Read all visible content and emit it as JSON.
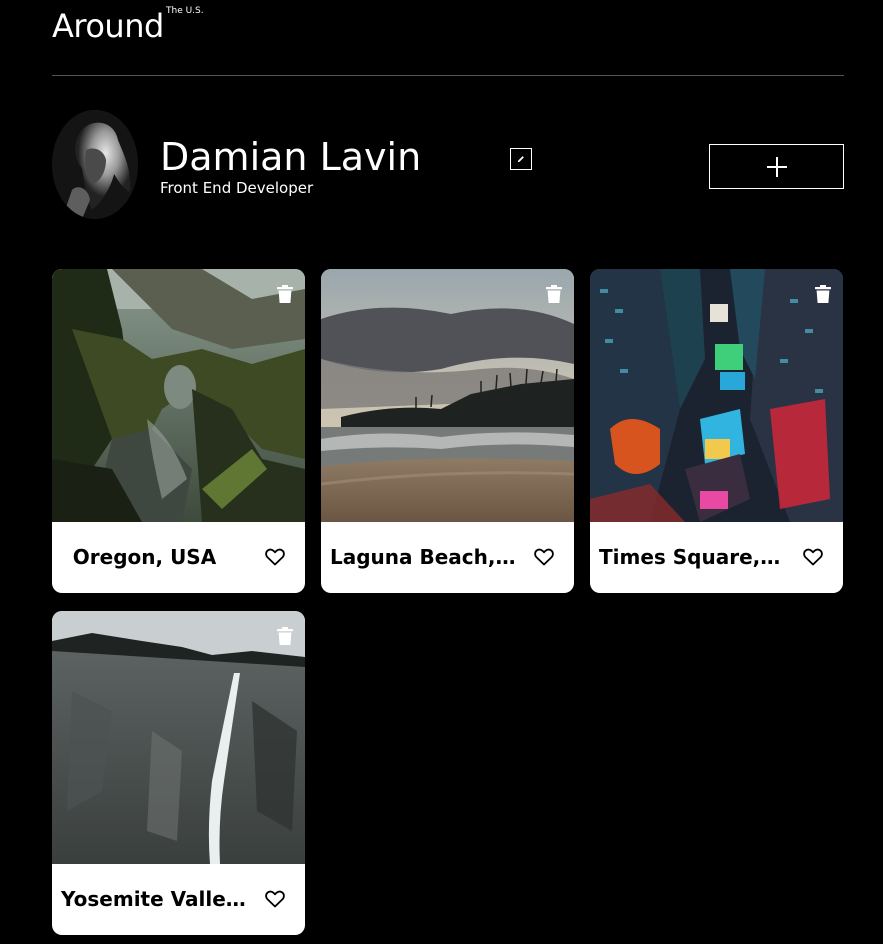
{
  "header": {
    "logo": "Around",
    "logo_sup": "The U.S."
  },
  "profile": {
    "name": "Damian Lavin",
    "job": "Front End Developer",
    "edit_icon": "pencil-icon",
    "add_icon": "plus-icon"
  },
  "cards": [
    {
      "title": "Oregon, USA",
      "image": "oregon-coast-photo"
    },
    {
      "title": "Laguna Beach, ...",
      "image": "laguna-beach-photo"
    },
    {
      "title": "Times Square, ...",
      "image": "times-square-photo"
    },
    {
      "title": "Yosemite Valley...",
      "image": "yosemite-photo"
    }
  ],
  "icons": {
    "delete": "trash-icon",
    "like": "heart-outline-icon"
  },
  "colors": {
    "background": "#000000",
    "card": "#ffffff",
    "divider": "#545454"
  }
}
